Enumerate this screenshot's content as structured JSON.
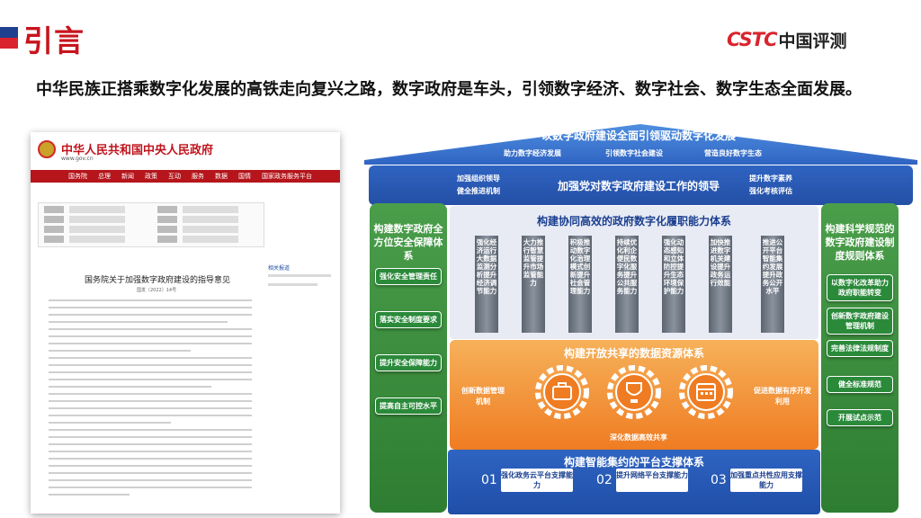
{
  "header": {
    "title": "引言",
    "logo_mark": "CSTC",
    "logo_text": "中国评测",
    "headline": "中华民族正搭乘数字化发展的高铁走向复兴之路，数字政府是车头，引领数字经济、数字社会、数字生态全面发展。"
  },
  "document": {
    "site_title": "中华人民共和国中央人民政府",
    "site_url": "www.gov.cn",
    "nav": [
      "国务院",
      "总理",
      "新闻",
      "政策",
      "互动",
      "服务",
      "数据",
      "国情",
      "国家政务服务平台"
    ],
    "article_title": "国务院关于加强数字政府建设的指导意见",
    "article_number": "国发〔2022〕14号",
    "side_title": "相关报道"
  },
  "diagram": {
    "roof": {
      "title": "以数字政府建设全面引领驱动数字化发展",
      "subs": [
        "助力数字经济发展",
        "引领数字社会建设",
        "营造良好数字生态"
      ]
    },
    "band": {
      "left": [
        "加强组织领导",
        "健全推进机制"
      ],
      "main": "加强党对数字政府建设工作的领导",
      "right": [
        "提升数字素养",
        "强化考核评估"
      ]
    },
    "left_pillar": {
      "title": "构建数字政府全方位安全保障体系",
      "items": [
        "强化安全管理责任",
        "落实安全制度要求",
        "提升安全保障能力",
        "提高自主可控水平"
      ]
    },
    "right_pillar": {
      "title": "构建科学规范的数字政府建设制度规则体系",
      "items": [
        "以数字化改革助力政府职能转变",
        "创新数字政府建设管理机制",
        "完善法律法规制度",
        "健全标准规范",
        "开展试点示范"
      ]
    },
    "middle": {
      "title": "构建协同高效的政府数字化履职能力体系",
      "columns": [
        "强化经济运行大数据监测分析提升经济调节能力",
        "大力推行智慧监管提升市场监管能力",
        "积极推动数字化治理模式创新提升社会管理能力",
        "持续优化利企便民数字化服务提升公共服务能力",
        "强化动态感知和立体防控提升生态环境保护能力",
        "加快推进数字机关建设提升政务运行效能",
        "推进公开平台智能集约发展提升政务公开水平"
      ]
    },
    "resource": {
      "title": "构建开放共享的数据资源体系",
      "left": "创新数据管理机制",
      "right": "促进数据有序开发利用",
      "bottom": "深化数据高效共享"
    },
    "platform": {
      "title": "构建智能集约的平台支撑体系",
      "items": [
        {
          "num": "01",
          "label": "强化政务云平台支撑能力"
        },
        {
          "num": "02",
          "label": "提升网络平台支撑能力"
        },
        {
          "num": "03",
          "label": "加强重点共性应用支撑能力"
        }
      ]
    }
  }
}
